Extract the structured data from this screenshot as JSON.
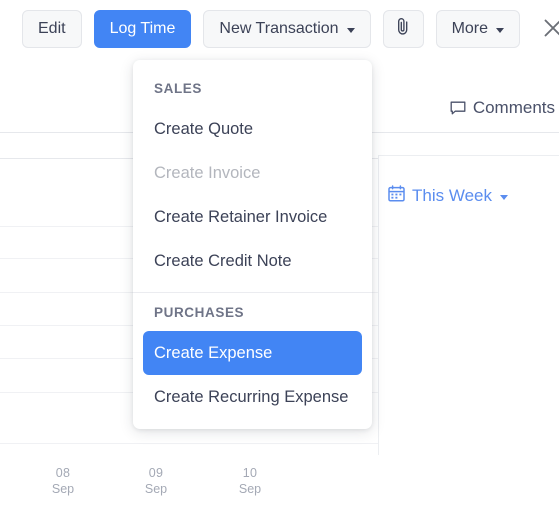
{
  "toolbar": {
    "buttons": [
      {
        "label": "Edit",
        "name": "edit-button",
        "variant": "default",
        "caret": false
      },
      {
        "label": "Log Time",
        "name": "log-time-button",
        "variant": "primary",
        "caret": false
      },
      {
        "label": "New Transaction",
        "name": "new-transaction-button",
        "variant": "default",
        "caret": true
      },
      {
        "label": "",
        "name": "attachment-button",
        "variant": "icon",
        "caret": false,
        "icon": "paperclip-icon"
      },
      {
        "label": "More",
        "name": "more-button",
        "variant": "default",
        "caret": true
      }
    ],
    "close_icon": "close-icon"
  },
  "dropdown": {
    "sections": [
      {
        "header": "SALES",
        "items": [
          {
            "label": "Create Quote",
            "state": "normal"
          },
          {
            "label": "Create Invoice",
            "state": "disabled"
          },
          {
            "label": "Create Retainer Invoice",
            "state": "normal"
          },
          {
            "label": "Create Credit Note",
            "state": "normal"
          }
        ]
      },
      {
        "header": "PURCHASES",
        "items": [
          {
            "label": "Create Expense",
            "state": "active"
          },
          {
            "label": "Create Recurring Expense",
            "state": "normal"
          }
        ]
      }
    ]
  },
  "background": {
    "comments_label": "Comments",
    "comments_icon": "comment-bubble-icon",
    "this_week_label": "This Week",
    "this_week_icon": "calendar-icon",
    "date_ticks": [
      {
        "day": "08",
        "month": "Sep"
      },
      {
        "day": "09",
        "month": "Sep"
      },
      {
        "day": "10",
        "month": "Sep"
      }
    ]
  },
  "colors": {
    "accent": "#4285f4",
    "link": "#5b8def",
    "text": "#3c4257",
    "muted": "#a4a9b5",
    "disabled": "#b3b6bd",
    "border": "#e4e6ea",
    "gridline": "#f0f1f4"
  }
}
